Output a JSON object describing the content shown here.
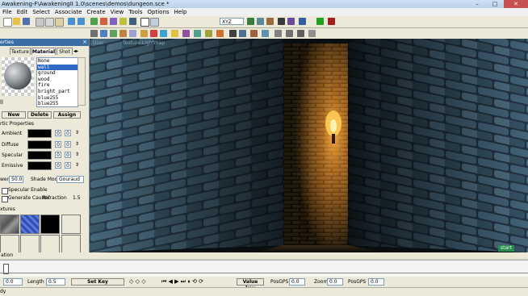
{
  "window": {
    "title": "Awakening-F\\AwakeningII 1.0\\scenes\\demos\\dungeon.sce *"
  },
  "menu": [
    "File",
    "Edit",
    "Select",
    "Associate",
    "Create",
    "View",
    "Tools",
    "Options",
    "Help"
  ],
  "toolbar": {
    "axis_dropdown": "XYZ"
  },
  "panel": {
    "title": "erties",
    "tabs": [
      "Texture",
      "Material",
      "Shot"
    ],
    "material_name": "ll",
    "materials": [
      "None",
      "wall",
      "ground",
      "wood",
      "fire",
      "bright_part",
      "blue255",
      "blue255"
    ],
    "selected_index": 1,
    "buttons": {
      "new": "New",
      "delete": "Delete",
      "assign": "Assign"
    },
    "properties_header": "rtic Properties",
    "ambient_label": "Ambient",
    "diffuse_label": "Diffuse",
    "specular_label": "Specular",
    "emissive_label": "Emissive",
    "value_0": "0",
    "power_label": "wer",
    "power_value": "50.0",
    "shade_mode_label": "Shade Mode",
    "shade_mode_value": "Gouraud",
    "specular_enable": "Specular Enable",
    "caustic_label": "Generate Caustic",
    "refraction_label": "Refraction",
    "refraction_value": "1.5",
    "textures_header": "xtures"
  },
  "viewport": {
    "label_user": "User",
    "label_texture": "Texture Lightmap",
    "start_label": "start"
  },
  "animation": {
    "label": "ation"
  },
  "status": {
    "frame_value": "0.0",
    "length_label": "Length",
    "length_value": "0.5",
    "set_key": "Set Key",
    "value_key": "Value key",
    "pos_label": "PosGPS",
    "pos_value": "0.0",
    "zoom_label": "Zoom",
    "zoom_value": "0.0",
    "posgps2_label": "PosGPS",
    "posgps2_value": "0.0",
    "ready": "dy"
  },
  "colors": {
    "brick_light": "#f0a030",
    "stone_blue": "#4a6e86",
    "selection": "#316ac5"
  }
}
